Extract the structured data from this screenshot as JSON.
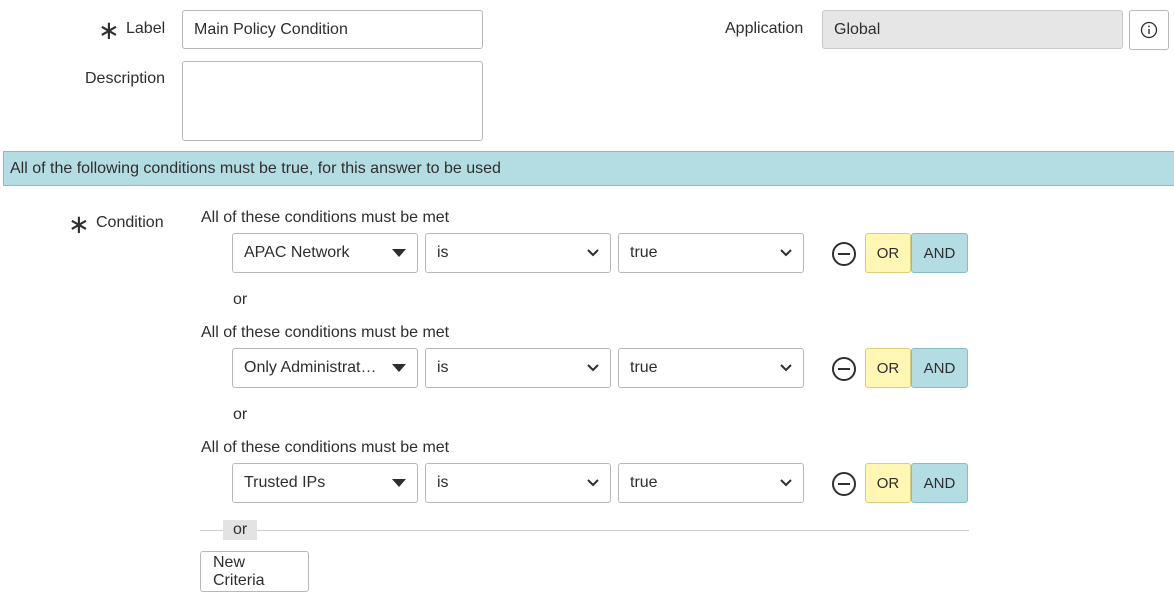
{
  "form": {
    "label": {
      "text": "Label",
      "value": "Main Policy Condition"
    },
    "description": {
      "text": "Description",
      "value": ""
    },
    "application": {
      "text": "Application",
      "value": "Global"
    }
  },
  "banner": "All of the following conditions must be true, for this answer to be used",
  "condition": {
    "label": "Condition",
    "or_separator": "or",
    "groups": [
      {
        "title": "All of these conditions must be met",
        "field": "APAC Network",
        "operator": "is",
        "value": "true"
      },
      {
        "title": "All of these conditions must be met",
        "field": "Only Administrat…",
        "operator": "is",
        "value": "true"
      },
      {
        "title": "All of these conditions must be met",
        "field": "Trusted IPs",
        "operator": "is",
        "value": "true"
      }
    ],
    "or_button": "OR",
    "and_button": "AND",
    "bottom_or": "or",
    "new_criteria": "New Criteria"
  },
  "icons": {
    "required": "asterisk-icon",
    "info": "info-icon",
    "remove": "minus-circle-icon",
    "field_dropdown": "caret-down-icon",
    "select_dropdown": "chevron-down-icon"
  }
}
